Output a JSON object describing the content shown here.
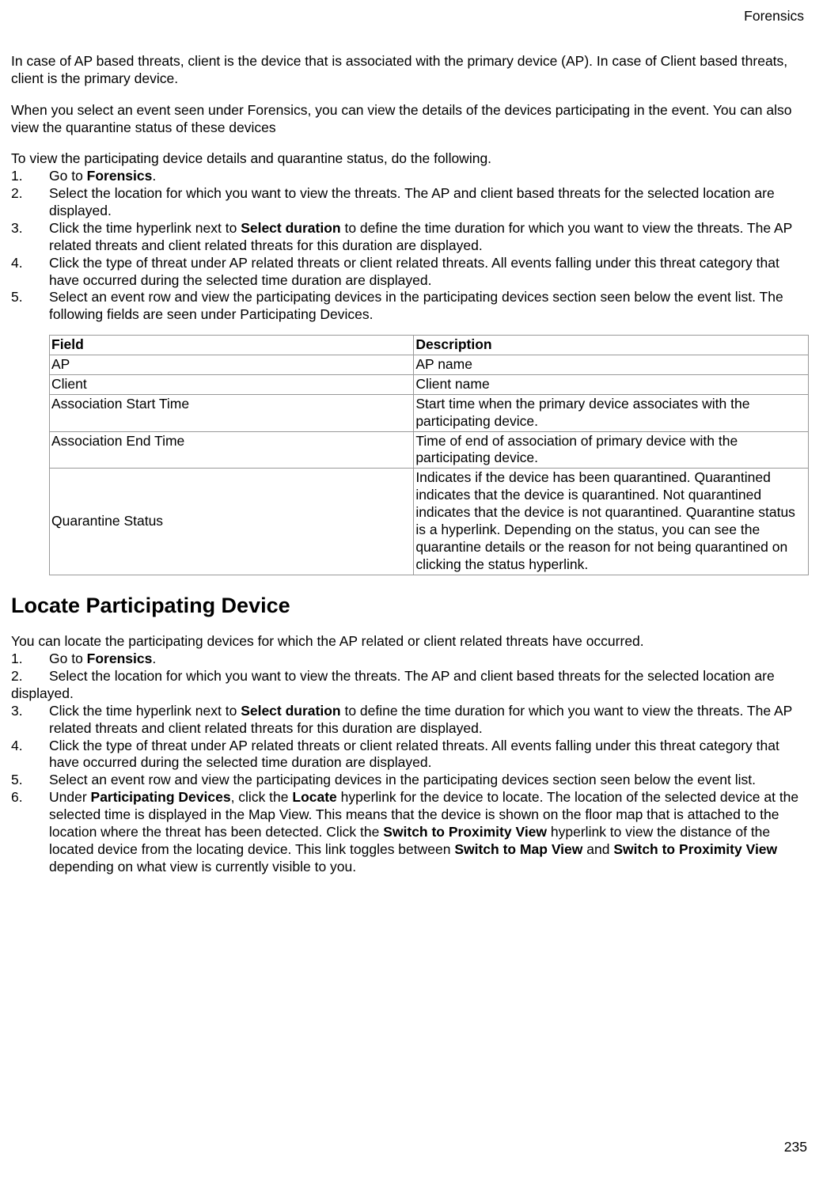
{
  "header": {
    "section": "Forensics"
  },
  "footer": {
    "page_number": "235"
  },
  "intro": {
    "p1": "In case of AP based threats, client is the device that is associated with the primary device (AP). In case of Client based threats, client is the primary device.",
    "p2": "When you select an event seen under Forensics, you can view the details of the devices participating in the event. You can also view the quarantine status of these devices",
    "p3": "To view the participating device details and quarantine status, do the following."
  },
  "list1": {
    "i1_a": "Go to ",
    "i1_b": "Forensics",
    "i1_c": ".",
    "i2": "Select the location for which you want to view the threats. The AP and client based threats for the selected location are displayed.",
    "i3_a": "Click the time hyperlink next to ",
    "i3_b": "Select duration",
    "i3_c": " to define the time duration for which you want to view the threats. The AP related threats and client related threats for this duration are displayed.",
    "i4": "Click the type of threat under AP related threats or client related threats. All events falling under this threat category that have occurred during the selected time duration are displayed.",
    "i5": "Select an event row and view the participating devices in the participating devices section seen below the event list. The following fields are seen under Participating Devices."
  },
  "table": {
    "h_field": "Field",
    "h_desc": "Description",
    "rows": {
      "r1f": "AP",
      "r1d": "AP name",
      "r2f": "Client",
      "r2d": "Client name",
      "r3f": "Association Start Time",
      "r3d": " Start time when the primary device associates with the participating device.",
      "r4f": "Association End Time",
      "r4d": "Time of end of association of primary device with the participating device.",
      "r5f": "Quarantine Status",
      "r5d": "Indicates if the device has been quarantined. Quarantined indicates that the device is quarantined. Not quarantined indicates that the device is not quarantined.  Quarantine status is a hyperlink. Depending on the status, you can see the quarantine details or the reason for not being quarantined on clicking the status hyperlink."
    }
  },
  "h2": "Locate Participating Device",
  "section2": {
    "intro": "You can locate the participating devices for which the AP related or client related threats have occurred.",
    "l1_a": "Go to ",
    "l1_b": "Forensics",
    "l1_c": ".",
    "l2": "Select the location for which you want to view the threats. The AP and client based threats for the selected location are displayed.",
    "l3_a": "Click the time hyperlink next to ",
    "l3_b": "Select duration",
    "l3_c": " to define the time duration for which you want to view the threats. The AP related threats and client related threats for this duration are displayed.",
    "l4": "Click the type of threat under AP related threats or client related threats. All events falling under this threat category that have occurred during the selected time duration are displayed.",
    "l5": "Select an event row and view the participating devices in the participating devices section seen below the event list.",
    "l6_a": "Under ",
    "l6_b": "Participating Devices",
    "l6_c": ", click the ",
    "l6_d": "Locate",
    "l6_e": " hyperlink for the device to locate. The location of the selected device at the selected time is displayed in the Map View. This means that the device is shown on the floor map that is attached to the location where the threat has been detected. Click the ",
    "l6_f": "Switch to Proximity View",
    "l6_g": " hyperlink to view the distance of the located device from the locating device. This link toggles between ",
    "l6_h": "Switch to Map View",
    "l6_i": " and ",
    "l6_j": "Switch to Proximity View",
    "l6_k": " depending on what view is currently visible to you."
  },
  "nums": {
    "n1": "1.",
    "n2": "2."
  }
}
